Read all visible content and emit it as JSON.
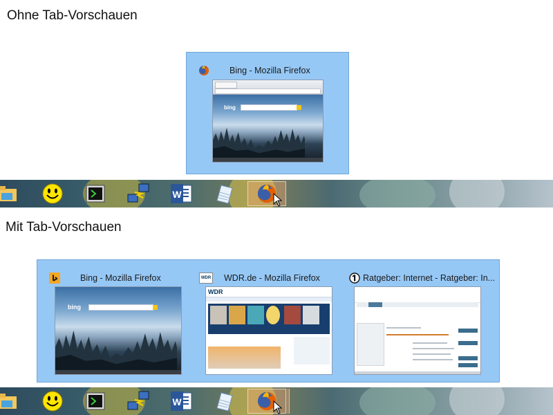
{
  "section_without": {
    "heading": "Ohne Tab-Vorschauen"
  },
  "section_with": {
    "heading": "Mit Tab-Vorschauen"
  },
  "previews_without": [
    {
      "title": "Bing - Mozilla Firefox",
      "icon": "firefox-icon"
    }
  ],
  "previews_with": [
    {
      "title": "Bing - Mozilla Firefox",
      "icon": "bing-icon"
    },
    {
      "title": "WDR.de - Mozilla Firefox",
      "icon": "wdr-icon"
    },
    {
      "title": "Ratgeber: Internet - Ratgeber: In...",
      "icon": "ard-icon"
    }
  ],
  "thumb_text": {
    "bing_logo": "bing",
    "wdr_logo": "WDR"
  },
  "taskbar": {
    "items": [
      {
        "name": "file-explorer-icon"
      },
      {
        "name": "smiley-icon"
      },
      {
        "name": "terminal-icon"
      },
      {
        "name": "network-icon"
      },
      {
        "name": "word-icon",
        "label": "W"
      },
      {
        "name": "notepad-icon"
      },
      {
        "name": "firefox-icon",
        "active": true
      }
    ]
  },
  "colors": {
    "preview_background": "#96c8f6",
    "preview_border": "#6ea6d9",
    "word_blue": "#2b579a",
    "bing_yellow": "#f5a623",
    "firefox_orange": "#e66000"
  }
}
